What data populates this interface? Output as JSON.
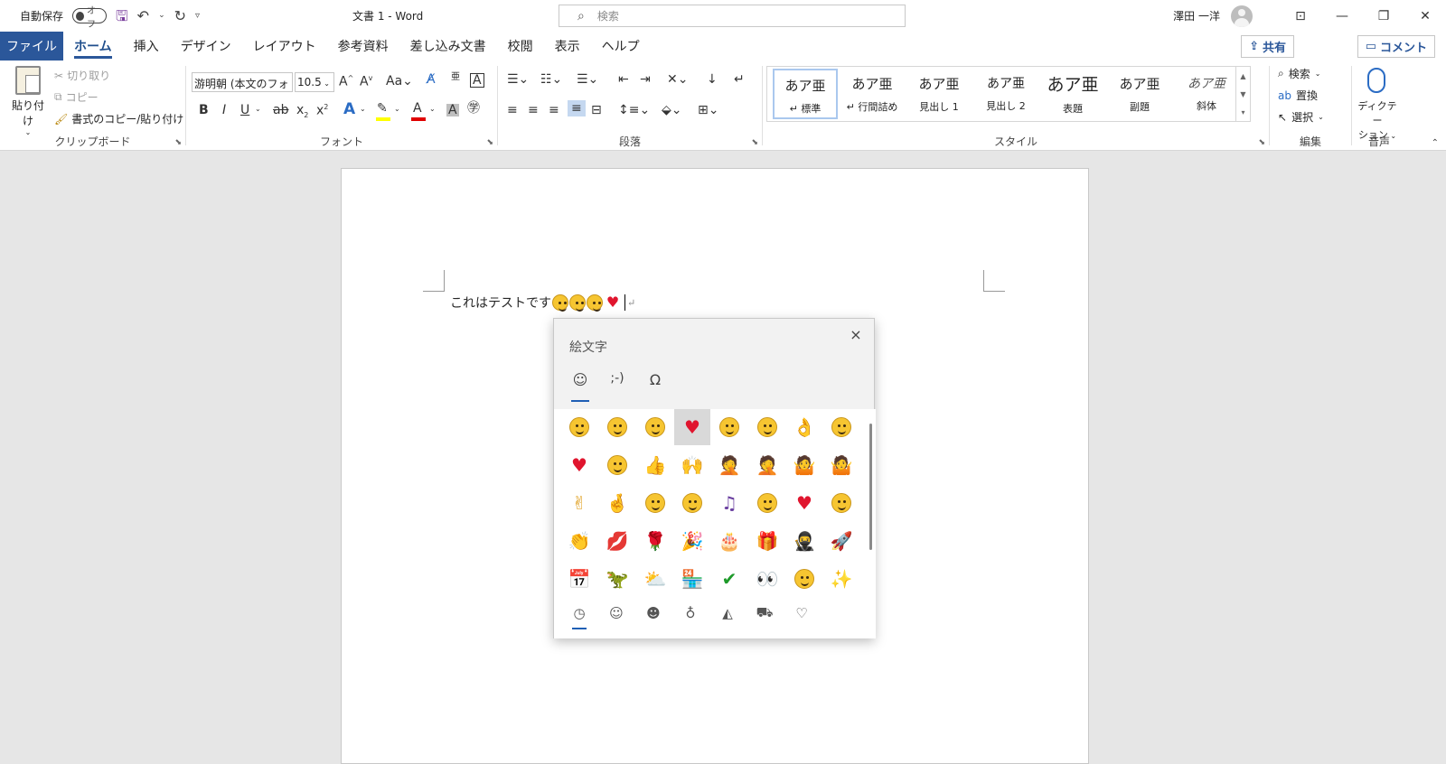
{
  "titlebar": {
    "autosave_label": "自動保存",
    "autosave_state": "オフ",
    "doc_title": "文書 1 - Word",
    "search_placeholder": "検索",
    "user_name": "澤田 一洋"
  },
  "tabs": [
    "ファイル",
    "ホーム",
    "挿入",
    "デザイン",
    "レイアウト",
    "参考資料",
    "差し込み文書",
    "校閲",
    "表示",
    "ヘルプ"
  ],
  "share_label": "共有",
  "comment_label": "コメント",
  "clipboard": {
    "paste_label": "貼り付け",
    "cut_label": "切り取り",
    "copy_label": "コピー",
    "format_painter_label": "書式のコピー/貼り付け",
    "group_label": "クリップボード"
  },
  "font": {
    "font_name": "游明朝 (本文のフォ",
    "font_size": "10.5",
    "group_label": "フォント"
  },
  "paragraph": {
    "group_label": "段落"
  },
  "styles": {
    "items": [
      {
        "preview": "あア亜",
        "name": "↵ 標準"
      },
      {
        "preview": "あア亜",
        "name": "↵ 行間詰め"
      },
      {
        "preview": "あア亜",
        "name": "見出し 1"
      },
      {
        "preview": "あア亜",
        "name": "見出し 2"
      },
      {
        "preview": "あア亜",
        "name": "表題"
      },
      {
        "preview": "あア亜",
        "name": "副題"
      },
      {
        "preview": "あア亜",
        "name": "斜体"
      }
    ],
    "group_label": "スタイル"
  },
  "editing": {
    "find_label": "検索",
    "replace_label": "置換",
    "select_label": "選択",
    "group_label": "編集"
  },
  "voice": {
    "dictate_label_1": "ディクテー",
    "dictate_label_2": "ション",
    "group_label": "音声"
  },
  "document": {
    "text": "これはテストです"
  },
  "emoji_panel": {
    "title": "絵文字",
    "tabs": [
      "☺",
      ";-)",
      "Ω"
    ],
    "close_icon": "×"
  }
}
